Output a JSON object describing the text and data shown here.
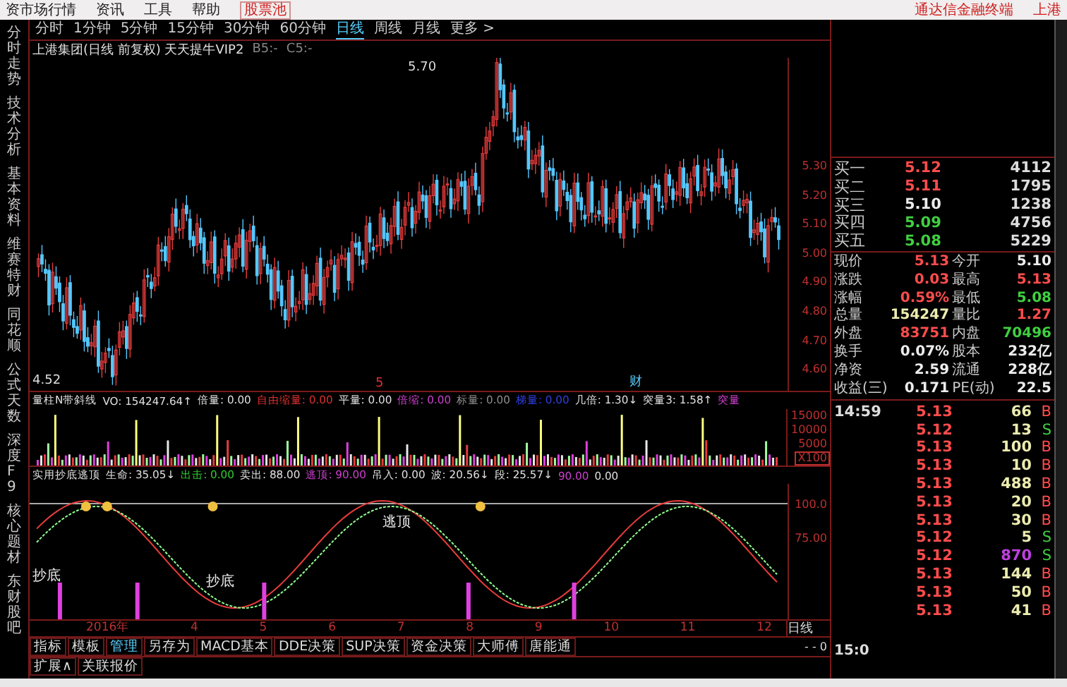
{
  "menu": {
    "items": [
      {
        "label": "资市场行情",
        "kind": "plain"
      },
      {
        "label": "资讯",
        "kind": "plain"
      },
      {
        "label": "工具",
        "kind": "plain"
      },
      {
        "label": "帮助",
        "kind": "plain"
      },
      {
        "label": "股票池",
        "kind": "boxed"
      }
    ],
    "brand": "通达信金融终端",
    "brand_extra": "上港"
  },
  "side_tabs": [
    "分时走势",
    "技术分析",
    "基本资料",
    "维赛特财",
    "同花顺",
    "公式天数",
    "深度F9",
    "核心题材",
    "东财股吧"
  ],
  "periods": [
    {
      "label": "分时",
      "selected": false
    },
    {
      "label": "1分钟",
      "selected": false
    },
    {
      "label": "5分钟",
      "selected": false
    },
    {
      "label": "15分钟",
      "selected": false
    },
    {
      "label": "30分钟",
      "selected": false
    },
    {
      "label": "60分钟",
      "selected": false
    },
    {
      "label": "日线",
      "selected": true
    },
    {
      "label": "周线",
      "selected": false
    },
    {
      "label": "月线",
      "selected": false
    },
    {
      "label": "更多 >",
      "selected": false
    }
  ],
  "chart_title": {
    "name": "上港集团(日线 前复权) 天天提牛VIP2",
    "b5": "B5:-",
    "c5": "C5:-"
  },
  "price_axis": [
    "5.30",
    "5.20",
    "5.10",
    "5.00",
    "4.90",
    "4.80",
    "4.70",
    "4.60"
  ],
  "price_marks": {
    "high": "5.70",
    "low": "4.52",
    "event_a": "5",
    "event_b": "财"
  },
  "volume_header": [
    {
      "text": "量柱N带斜线",
      "color": "#e0e0e0"
    },
    {
      "text": "VO: 154247.64↑",
      "color": "#e0e0e0"
    },
    {
      "text": "倍量: 0.00",
      "color": "#e0e0e0"
    },
    {
      "text": "自由缩量: 0.00",
      "color": "#e03030"
    },
    {
      "text": "平量: 0.00",
      "color": "#e0e0e0"
    },
    {
      "text": "倍缩: 0.00",
      "color": "#d040d0"
    },
    {
      "text": "标量: 0.00",
      "color": "#909090"
    },
    {
      "text": "梯量: 0.00",
      "color": "#3040e0"
    },
    {
      "text": "几倍: 1.30↓",
      "color": "#e0e0e0"
    },
    {
      "text": "突量3: 1.58↑",
      "color": "#e0e0e0"
    },
    {
      "text": "突量",
      "color": "#d040d0"
    }
  ],
  "volume_axis": [
    "15000",
    "10000",
    "5000"
  ],
  "volume_unit": "X100",
  "indicator_header": [
    {
      "text": "实用抄底逃顶",
      "color": "#e0e0e0"
    },
    {
      "text": "生命: 35.05↓",
      "color": "#e0e0e0"
    },
    {
      "text": "出击: 0.00",
      "color": "#30d030"
    },
    {
      "text": "卖出: 88.00",
      "color": "#e0e0e0"
    },
    {
      "text": "逃顶: 90.00",
      "color": "#d040d0"
    },
    {
      "text": "吊入: 0.00",
      "color": "#e0e0e0"
    },
    {
      "text": "波: 20.56↓",
      "color": "#e0e0e0"
    },
    {
      "text": "段: 25.57↓",
      "color": "#e0e0e0"
    },
    {
      "text": "90.00",
      "color": "#d040d0"
    },
    {
      "text": "0.00",
      "color": "#e0e0e0"
    }
  ],
  "indicator_axis": [
    "100.0",
    "75.00"
  ],
  "indicator_labels": [
    "抄底",
    "逃顶",
    "抄底"
  ],
  "date_axis": [
    "2016年",
    "4",
    "5",
    "6",
    "7",
    "8",
    "9",
    "10",
    "11",
    "12"
  ],
  "period_box": {
    "label": "日线",
    "value": "- - 0"
  },
  "bottom_tabs": [
    {
      "label": "指标",
      "selected": false
    },
    {
      "label": "模板",
      "selected": false
    },
    {
      "label": "管理",
      "selected": true
    },
    {
      "label": "另存为",
      "selected": false
    },
    {
      "label": "MACD基本",
      "selected": false
    },
    {
      "label": "DDE决策",
      "selected": false
    },
    {
      "label": "SUP决策",
      "selected": false
    },
    {
      "label": "资金决策",
      "selected": false
    },
    {
      "label": "大师傅",
      "selected": false
    },
    {
      "label": "唐能通",
      "selected": false
    }
  ],
  "extra_tabs": [
    "扩展∧",
    "关联报价"
  ],
  "bids": [
    {
      "label": "买一",
      "price": "5.12",
      "color": "#ff4c4c",
      "volume": "4112"
    },
    {
      "label": "买二",
      "price": "5.11",
      "color": "#ff4c4c",
      "volume": "1795"
    },
    {
      "label": "买三",
      "price": "5.10",
      "color": "#ececec",
      "volume": "1238"
    },
    {
      "label": "买四",
      "price": "5.09",
      "color": "#40d040",
      "volume": "4756"
    },
    {
      "label": "买五",
      "price": "5.08",
      "color": "#40d040",
      "volume": "5229"
    }
  ],
  "stats": [
    {
      "label": "现价",
      "value": "5.13",
      "color": "#ff4c4c"
    },
    {
      "label": "今开",
      "value": "5.10",
      "color": "#ececec"
    },
    {
      "label": "涨跌",
      "value": "0.03",
      "color": "#ff4c4c"
    },
    {
      "label": "最高",
      "value": "5.13",
      "color": "#ff4c4c"
    },
    {
      "label": "涨幅",
      "value": "0.59%",
      "color": "#ff4c4c"
    },
    {
      "label": "最低",
      "value": "5.08",
      "color": "#40d040"
    },
    {
      "label": "总量",
      "value": "154247",
      "color": "#ececb0"
    },
    {
      "label": "量比",
      "value": "1.27",
      "color": "#ff4c4c"
    },
    {
      "label": "外盘",
      "value": "83751",
      "color": "#ff4c4c"
    },
    {
      "label": "内盘",
      "value": "70496",
      "color": "#40d040"
    },
    {
      "label": "换手",
      "value": "0.07%",
      "color": "#ececec"
    },
    {
      "label": "股本",
      "value": "232亿",
      "color": "#ececec"
    },
    {
      "label": "净资",
      "value": "2.59",
      "color": "#ececec"
    },
    {
      "label": "流通",
      "value": "228亿",
      "color": "#ececec"
    },
    {
      "label": "收益(三)",
      "value": "0.171",
      "color": "#ececec"
    },
    {
      "label": "PE(动)",
      "value": "22.5",
      "color": "#ececec"
    }
  ],
  "ticks": [
    {
      "time": "14:59",
      "price": "5.13",
      "volume": "66",
      "big": false,
      "side": "B"
    },
    {
      "price": "5.12",
      "volume": "13",
      "big": false,
      "side": "S"
    },
    {
      "price": "5.13",
      "volume": "100",
      "big": false,
      "side": "B"
    },
    {
      "price": "5.13",
      "volume": "10",
      "big": false,
      "side": "B"
    },
    {
      "price": "5.13",
      "volume": "488",
      "big": false,
      "side": "B"
    },
    {
      "price": "5.13",
      "volume": "20",
      "big": false,
      "side": "B"
    },
    {
      "price": "5.13",
      "volume": "30",
      "big": false,
      "side": "B"
    },
    {
      "price": "5.12",
      "volume": "5",
      "big": false,
      "side": "S"
    },
    {
      "price": "5.12",
      "volume": "870",
      "big": true,
      "side": "S"
    },
    {
      "price": "5.13",
      "volume": "144",
      "big": false,
      "side": "B"
    },
    {
      "price": "5.13",
      "volume": "50",
      "big": false,
      "side": "B"
    },
    {
      "price": "5.13",
      "volume": "41",
      "big": false,
      "side": "B"
    }
  ],
  "tick_footer": "15:0"
}
